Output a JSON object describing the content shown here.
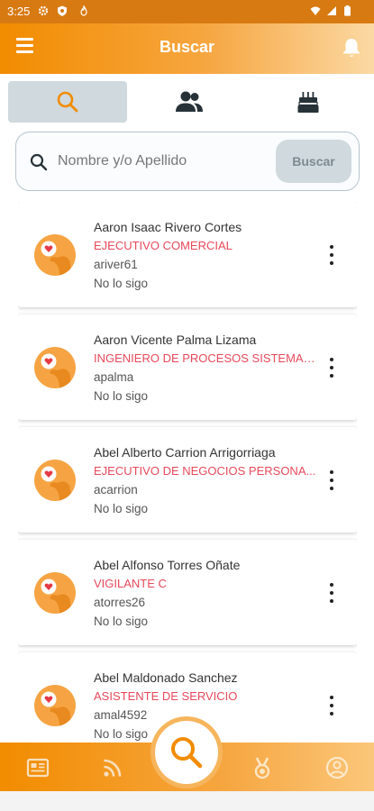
{
  "status_bar": {
    "time": "3:25"
  },
  "header": {
    "title": "Buscar"
  },
  "tabs": [
    {
      "icon": "search-icon",
      "active": true
    },
    {
      "icon": "people-icon",
      "active": false
    },
    {
      "icon": "birthday-cake-icon",
      "active": false
    }
  ],
  "search": {
    "placeholder": "Nombre y/o Apellido",
    "value": "",
    "button_label": "Buscar"
  },
  "results": [
    {
      "name": "Aaron Isaac Rivero Cortes",
      "role": "EJECUTIVO COMERCIAL",
      "username": "ariver61",
      "follow_status": "No lo sigo"
    },
    {
      "name": "Aaron Vicente Palma Lizama",
      "role": "INGENIERO DE PROCESOS SISTEMAS ...",
      "username": "apalma",
      "follow_status": "No lo sigo"
    },
    {
      "name": "Abel Alberto Carrion Arrigorriaga",
      "role": "EJECUTIVO DE NEGOCIOS PERSONA...",
      "username": "acarrion",
      "follow_status": "No lo sigo"
    },
    {
      "name": "Abel Alfonso Torres Oñate",
      "role": "VIGILANTE C",
      "username": "atorres26",
      "follow_status": "No lo sigo"
    },
    {
      "name": "Abel Maldonado Sanchez",
      "role": "ASISTENTE DE SERVICIO",
      "username": "amal4592",
      "follow_status": "No lo sigo"
    }
  ],
  "bottom_nav": [
    {
      "icon": "news-icon"
    },
    {
      "icon": "rss-icon"
    },
    {
      "icon": "search-icon",
      "active": true
    },
    {
      "icon": "medal-icon"
    },
    {
      "icon": "profile-icon"
    }
  ],
  "colors": {
    "brand_orange": "#f28c00",
    "role_red": "#e6495a",
    "tab_active": "#cfd9de"
  }
}
